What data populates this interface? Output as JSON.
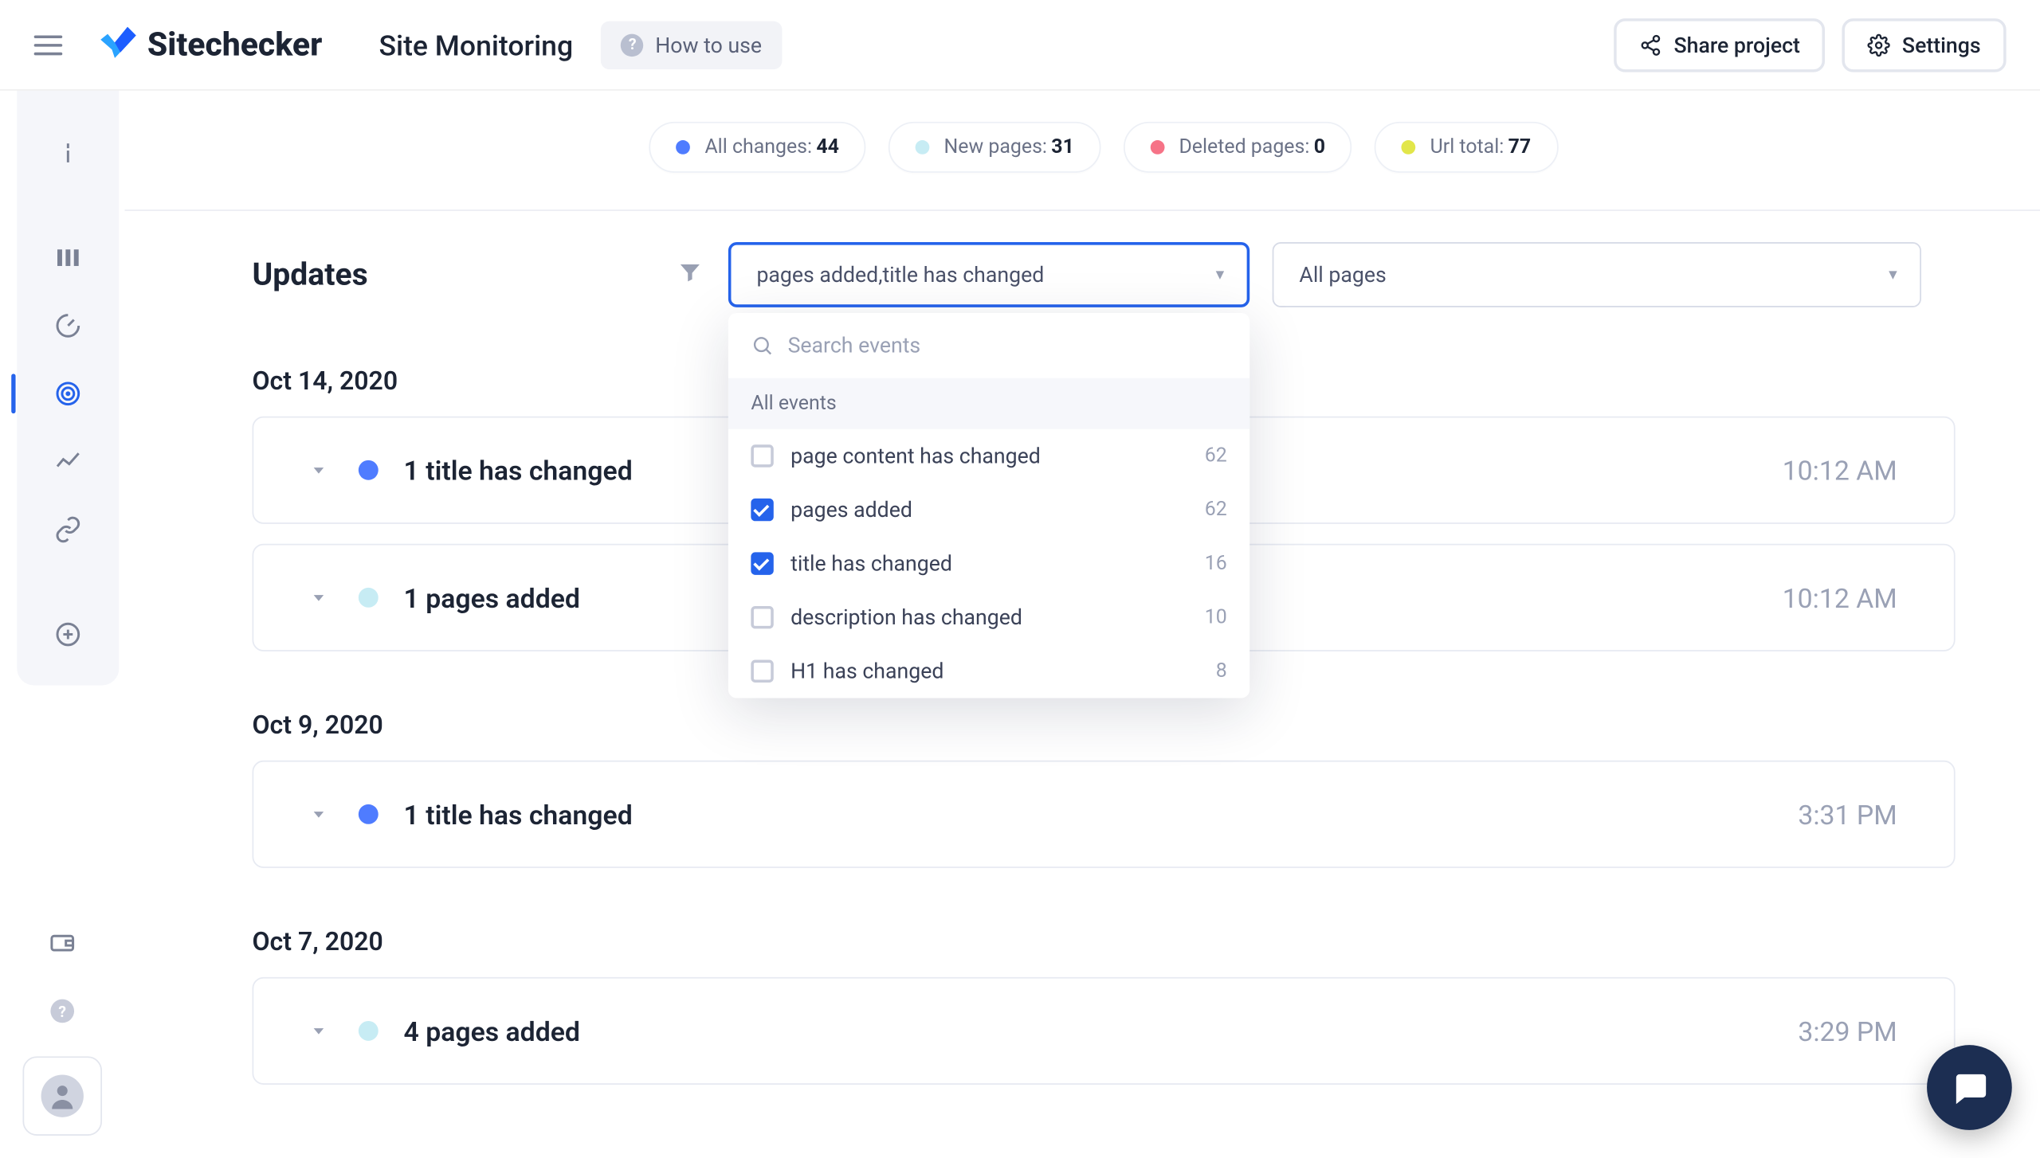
{
  "header": {
    "brand": "Sitechecker",
    "page_title": "Site Monitoring",
    "how_to_use": "How to use",
    "share_project": "Share project",
    "settings": "Settings"
  },
  "stats": {
    "all_changes": {
      "label": "All changes:",
      "value": "44",
      "color": "#4f7cff"
    },
    "new_pages": {
      "label": "New pages:",
      "value": "31",
      "color": "#c7ecf4"
    },
    "deleted_pages": {
      "label": "Deleted pages:",
      "value": "0",
      "color": "#f67387"
    },
    "url_total": {
      "label": "Url total:",
      "value": "77",
      "color": "#e2e64a"
    }
  },
  "controls": {
    "section_title": "Updates",
    "events_select_value": "pages added,title has changed",
    "pages_select_value": "All pages"
  },
  "dropdown": {
    "search_placeholder": "Search events",
    "all_events_label": "All events",
    "options": [
      {
        "label": "page content has changed",
        "count": "62",
        "checked": false
      },
      {
        "label": "pages added",
        "count": "62",
        "checked": true
      },
      {
        "label": "title has changed",
        "count": "16",
        "checked": true
      },
      {
        "label": "description has changed",
        "count": "10",
        "checked": false
      },
      {
        "label": "H1 has changed",
        "count": "8",
        "checked": false
      }
    ]
  },
  "groups": [
    {
      "date": "Oct 14, 2020",
      "items": [
        {
          "text": "1 title has changed",
          "time": "10:12 AM",
          "dot": "dot-blue"
        },
        {
          "text": "1 pages added",
          "time": "10:12 AM",
          "dot": "dot-cyan"
        }
      ]
    },
    {
      "date": "Oct 9, 2020",
      "items": [
        {
          "text": "1 title has changed",
          "time": "3:31 PM",
          "dot": "dot-blue"
        }
      ]
    },
    {
      "date": "Oct 7, 2020",
      "items": [
        {
          "text": "4 pages added",
          "time": "3:29 PM",
          "dot": "dot-cyan"
        }
      ]
    }
  ]
}
